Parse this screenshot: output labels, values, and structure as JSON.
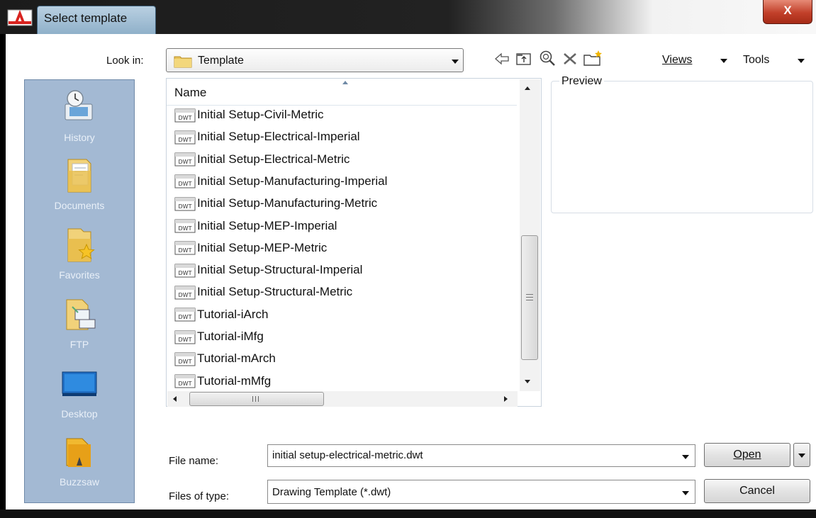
{
  "window": {
    "title": "Select template",
    "close_label": "X"
  },
  "look_in": {
    "label": "Look in:",
    "value": "Template"
  },
  "toolbar": {
    "back_icon": "arrow-left-icon",
    "up_folder_icon": "up-one-level-icon",
    "search_web_icon": "search-web-icon",
    "delete_icon": "delete-x-icon",
    "new_folder_icon": "new-folder-icon",
    "views_label": "Views",
    "tools_label": "Tools"
  },
  "places": [
    {
      "label": "History",
      "icon": "history-icon"
    },
    {
      "label": "Documents",
      "icon": "documents-folder-icon"
    },
    {
      "label": "Favorites",
      "icon": "favorites-folder-icon"
    },
    {
      "label": "FTP",
      "icon": "ftp-icon"
    },
    {
      "label": "Desktop",
      "icon": "desktop-icon"
    },
    {
      "label": "Buzzsaw",
      "icon": "buzzsaw-icon"
    }
  ],
  "file_list": {
    "column_header": "Name",
    "files": [
      "Initial Setup-Civil-Metric",
      "Initial Setup-Electrical-Imperial",
      "Initial Setup-Electrical-Metric",
      "Initial Setup-Manufacturing-Imperial",
      "Initial Setup-Manufacturing-Metric",
      "Initial Setup-MEP-Imperial",
      "Initial Setup-MEP-Metric",
      "Initial Setup-Structural-Imperial",
      "Initial Setup-Structural-Metric",
      "Tutorial-iArch",
      "Tutorial-iMfg",
      "Tutorial-mArch",
      "Tutorial-mMfg"
    ],
    "file_icon_text": "DWT"
  },
  "preview": {
    "label": "Preview"
  },
  "file_name": {
    "label": "File name:",
    "value": "initial setup-electrical-metric.dwt"
  },
  "files_of_type": {
    "label": "Files of type:",
    "value": "Drawing Template (*.dwt)"
  },
  "buttons": {
    "open_label": "Open",
    "cancel_label": "Cancel"
  }
}
